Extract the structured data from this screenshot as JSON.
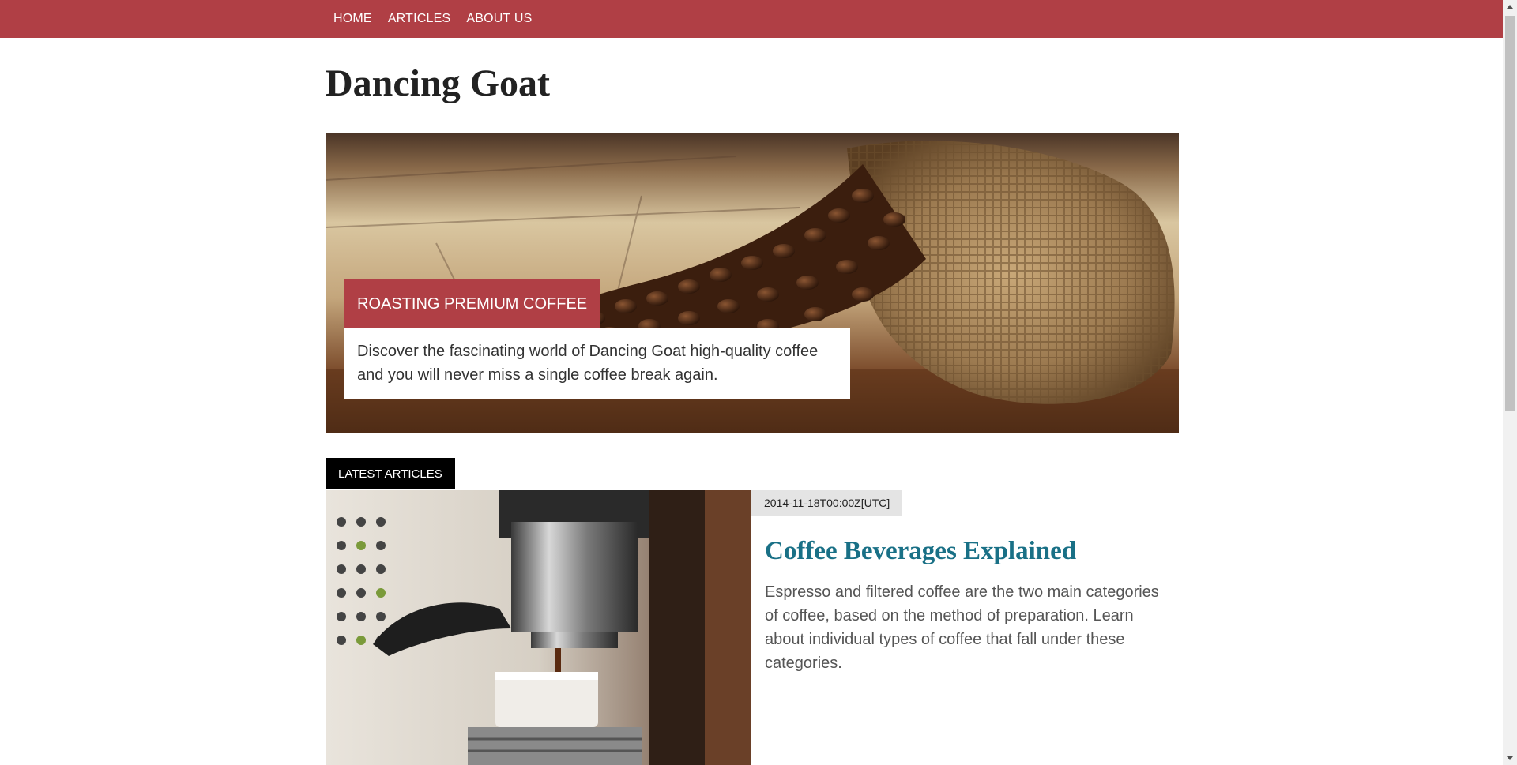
{
  "nav": {
    "items": [
      {
        "label": "HOME"
      },
      {
        "label": "ARTICLES"
      },
      {
        "label": "ABOUT US"
      }
    ]
  },
  "site": {
    "title": "Dancing Goat"
  },
  "hero": {
    "title": "ROASTING PREMIUM COFFEE",
    "description": "Discover the fascinating world of Dancing Goat high-quality coffee and you will never miss a single coffee break again."
  },
  "latest": {
    "label": "LATEST ARTICLES",
    "articles": [
      {
        "date": "2014-11-18T00:00Z[UTC]",
        "title": "Coffee Beverages Explained",
        "summary": "Espresso and filtered coffee are the two main categories of coffee, based on the method of preparation. Learn about individual types of coffee that fall under these categories."
      }
    ]
  },
  "colors": {
    "brand": "#b03f45",
    "article_title": "#197086",
    "label_bg": "#000000",
    "date_bg": "#e4e4e4"
  }
}
